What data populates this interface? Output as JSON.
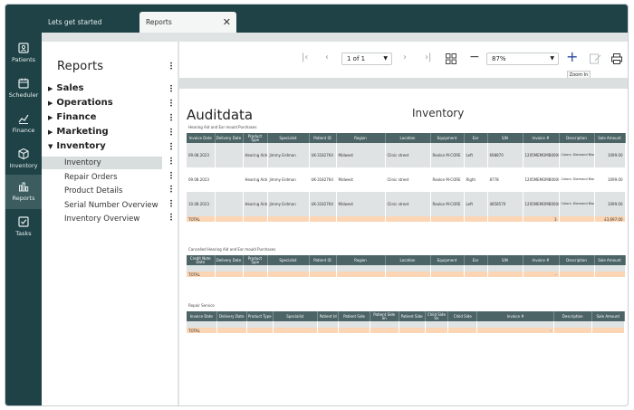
{
  "tabs": [
    {
      "label": "Lets get started"
    },
    {
      "label": "Reports"
    }
  ],
  "rail": [
    {
      "label": "Patients",
      "icon": "id-card-icon"
    },
    {
      "label": "Scheduler",
      "icon": "calendar-icon"
    },
    {
      "label": "Finance",
      "icon": "chart-line-icon"
    },
    {
      "label": "Inventory",
      "icon": "box-icon"
    },
    {
      "label": "Reports",
      "icon": "bar-chart-icon"
    },
    {
      "label": "Tasks",
      "icon": "checkbox-icon"
    }
  ],
  "nav": {
    "title": "Reports",
    "categories": [
      "Sales",
      "Operations",
      "Finance",
      "Marketing",
      "Inventory"
    ],
    "inventory_items": [
      "Inventory",
      "Repair Orders",
      "Product Details",
      "Serial Number Overview",
      "Inventory Overview"
    ]
  },
  "toolbar": {
    "page": "1 of 1",
    "zoom": "87%",
    "tooltip": "Zoom In"
  },
  "report": {
    "brand": "Auditdata",
    "title": "Inventory",
    "section1": {
      "caption": "Hearing Aid and Ear mould Purchases",
      "headers": [
        "Invoice Date",
        "Delivery Date",
        "Product Type",
        "Specialist",
        "Patient ID",
        "Region",
        "Location",
        "Equipment",
        "Ear",
        "S/N",
        "Invoice #",
        "Description",
        "Sale Amount"
      ],
      "rows": [
        [
          "09.08.2023",
          "",
          "Hearing Aids",
          "Jimmy Erdman",
          "UK-3182764",
          "Midwest",
          "Clinic street",
          "Realon M-CORE",
          "Left",
          "698870",
          "1205MEMOMB000000",
          "Colors:\nDiamond Black\nChroma Beige\nGraphite\nSilver\nSilver Grey\nPearl Grey",
          "1099.00"
        ],
        [
          "09.08.2023",
          "",
          "Hearing Aids",
          "Jimmy Erdman",
          "UK-3182764",
          "Midwest",
          "Clinic street",
          "Realon M-CORE",
          "Right",
          "8778",
          "1205MEMOMB000000",
          "Colors:\nDiamond Black\nChroma Beige\nGraphite\nSilver\nSilver Grey\nPearl Grey",
          "1099.00"
        ],
        [
          "10.08.2023",
          "",
          "Hearing Aids",
          "Jimmy Erdman",
          "UK-3182764",
          "Midwest",
          "Clinic street",
          "Realon M-CORE",
          "Left",
          "4858570",
          "1205MEMOMB000000",
          "Colors:\nDiamond Black\nChroma Beige\nGraphite\nSilver\nSilver Grey\nPearl Grey",
          "1099.00"
        ]
      ],
      "total": {
        "label": "TOTAL",
        "count": "3",
        "amount": "£3,697.00"
      }
    },
    "section2": {
      "caption": "Cancelled Hearing Aid and Ear mould Purchases",
      "headers": [
        "Credit Note Date",
        "Delivery Date",
        "Product Type",
        "Specialist",
        "Patient ID",
        "Region",
        "Location",
        "Equipment",
        "Ear",
        "S/N",
        "Invoice #",
        "Description",
        "Sale Amount"
      ],
      "total": {
        "label": "TOTAL",
        "count": "-"
      }
    },
    "section3": {
      "caption": "Repair Service",
      "headers": [
        "Invoice Date",
        "Delivery Date",
        "Product Type",
        "Specialist",
        "Patient Id",
        "Patient Side",
        "Patient Side Sn",
        "Patient Side",
        "Child Side Sn",
        "Child Side",
        "Invoice #",
        "Description",
        "Sale Amount"
      ],
      "total": {
        "label": "TOTAL",
        "count": "-"
      }
    }
  }
}
